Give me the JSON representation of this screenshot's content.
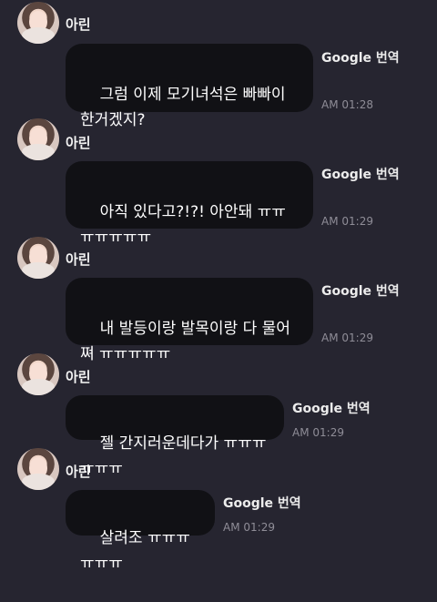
{
  "sender_name": "아린",
  "translate_label": "Google 번역",
  "messages": [
    {
      "text": "그럼 이제 모기녀석은 빠빠이한거겠지?",
      "time": "AM 01:28"
    },
    {
      "text": "아직 있다고?!?! 아안돼 ㅠㅠㅠㅠㅠㅠㅠ",
      "time": "AM 01:29"
    },
    {
      "text": "내 발등이랑 발목이랑 다 물어쪄 ㅠㅠㅠㅠㅠ",
      "time": "AM 01:29"
    },
    {
      "text": "젤 간지러운데다가 ㅠㅠㅠㅠㅠㅠ",
      "time": "AM 01:29"
    },
    {
      "text": "살려조 ㅠㅠㅠㅠㅠㅠ",
      "time": "AM 01:29"
    }
  ]
}
